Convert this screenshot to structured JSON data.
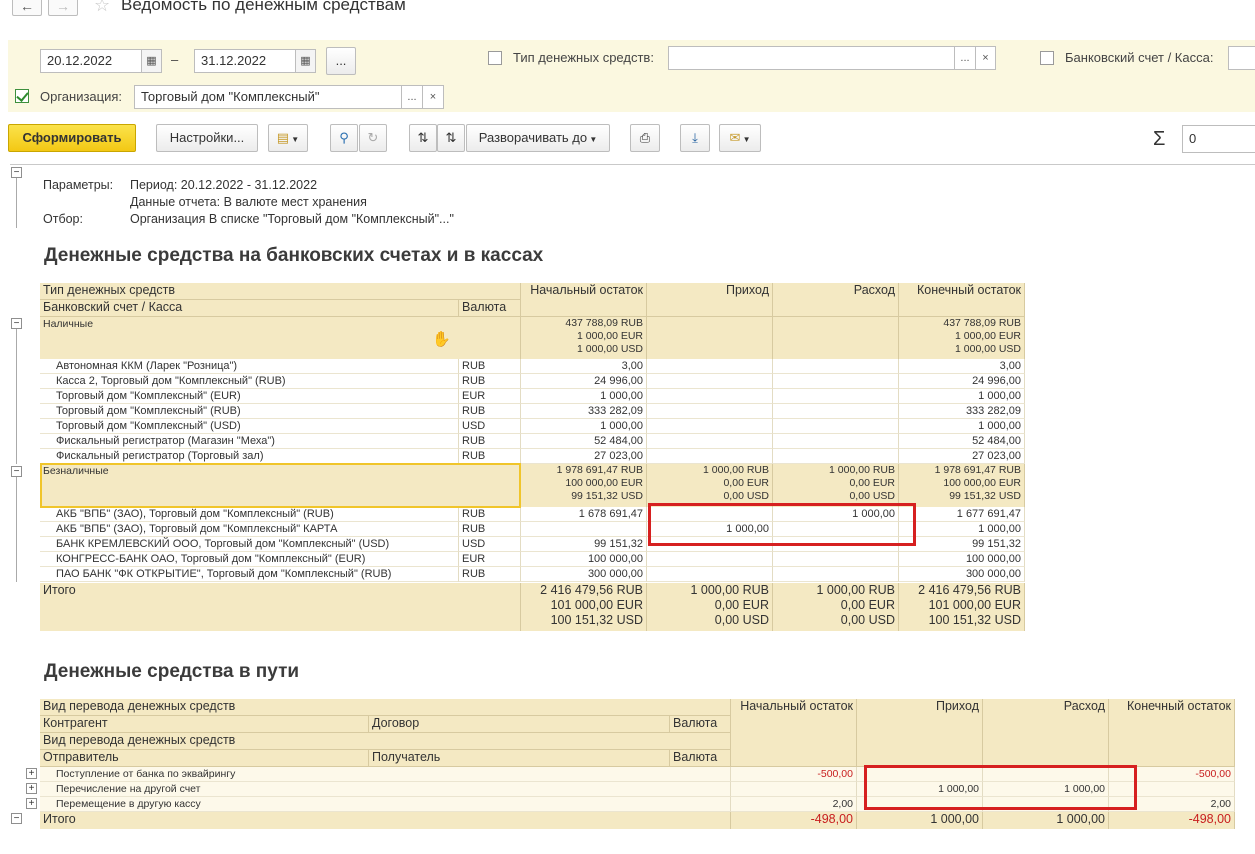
{
  "window": {
    "title": "Ведомость по денежным средствам"
  },
  "filters": {
    "date_from": "20.12.2022",
    "date_dash": "–",
    "date_to": "31.12.2022",
    "more": "...",
    "type_label": "Тип денежных средств:",
    "bank_label": "Банковский счет / Касса:",
    "org_label": "Организация:",
    "org_value": "Торговый дом \"Комплексный\"",
    "ellipsis": "...",
    "clear": "×"
  },
  "toolbar": {
    "generate": "Сформировать",
    "settings": "Настройки...",
    "expand": "Разворачивать до",
    "sigma": "Σ",
    "sum_value": "0"
  },
  "params": {
    "label": "Параметры:",
    "period": "Период: 20.12.2022 - 31.12.2022",
    "data": "Данные отчета: В валюте мест хранения",
    "filter_label": "Отбор:",
    "filter": "Организация В списке \"Торговый дом \"Комплексный\"...\""
  },
  "section1": {
    "title": "Денежные средства на банковских счетах и в кассах",
    "headers": {
      "type": "Тип денежных средств",
      "account": "Банковский счет / Касса",
      "currency": "Валюта",
      "opening": "Начальный остаток",
      "income": "Приход",
      "expense": "Расход",
      "closing": "Конечный остаток"
    },
    "cash_group": {
      "name": "Наличные",
      "opening": [
        "437 788,09 RUB",
        "1 000,00 EUR",
        "1 000,00 USD"
      ],
      "closing": [
        "437 788,09 RUB",
        "1 000,00 EUR",
        "1 000,00 USD"
      ]
    },
    "cash_rows": [
      {
        "name": "Автономная ККМ (Ларек \"Розница\")",
        "cur": "RUB",
        "opening": "3,00",
        "income": "",
        "expense": "",
        "closing": "3,00"
      },
      {
        "name": "Касса 2, Торговый дом \"Комплексный\" (RUB)",
        "cur": "RUB",
        "opening": "24 996,00",
        "income": "",
        "expense": "",
        "closing": "24 996,00"
      },
      {
        "name": "Торговый дом \"Комплексный\" (EUR)",
        "cur": "EUR",
        "opening": "1 000,00",
        "income": "",
        "expense": "",
        "closing": "1 000,00"
      },
      {
        "name": "Торговый дом \"Комплексный\" (RUB)",
        "cur": "RUB",
        "opening": "333 282,09",
        "income": "",
        "expense": "",
        "closing": "333 282,09"
      },
      {
        "name": "Торговый дом \"Комплексный\" (USD)",
        "cur": "USD",
        "opening": "1 000,00",
        "income": "",
        "expense": "",
        "closing": "1 000,00"
      },
      {
        "name": "Фискальный регистратор (Магазин \"Меха\")",
        "cur": "RUB",
        "opening": "52 484,00",
        "income": "",
        "expense": "",
        "closing": "52 484,00"
      },
      {
        "name": "Фискальный регистратор (Торговый зал)",
        "cur": "RUB",
        "opening": "27 023,00",
        "income": "",
        "expense": "",
        "closing": "27 023,00"
      }
    ],
    "noncash_group": {
      "name": "Безналичные",
      "opening": [
        "1 978 691,47 RUB",
        "100 000,00 EUR",
        "99 151,32 USD"
      ],
      "income": [
        "1 000,00 RUB",
        "0,00 EUR",
        "0,00 USD"
      ],
      "expense": [
        "1 000,00 RUB",
        "0,00 EUR",
        "0,00 USD"
      ],
      "closing": [
        "1 978 691,47 RUB",
        "100 000,00 EUR",
        "99 151,32 USD"
      ]
    },
    "noncash_rows": [
      {
        "name": "АКБ \"ВПБ\" (ЗАО), Торговый дом \"Комплексный\" (RUB)",
        "cur": "RUB",
        "opening": "1 678 691,47",
        "income": "",
        "expense": "1 000,00",
        "closing": "1 677 691,47"
      },
      {
        "name": "АКБ \"ВПБ\" (ЗАО), Торговый дом \"Комплексный\" КАРТА",
        "cur": "RUB",
        "opening": "",
        "income": "1 000,00",
        "expense": "",
        "closing": "1 000,00"
      },
      {
        "name": "БАНК КРЕМЛЕВСКИЙ ООО, Торговый дом \"Комплексный\" (USD)",
        "cur": "USD",
        "opening": "99 151,32",
        "income": "",
        "expense": "",
        "closing": "99 151,32"
      },
      {
        "name": "КОНГРЕСС-БАНК ОАО, Торговый дом \"Комплексный\" (EUR)",
        "cur": "EUR",
        "opening": "100 000,00",
        "income": "",
        "expense": "",
        "closing": "100 000,00"
      },
      {
        "name": "ПАО БАНК \"ФК ОТКРЫТИЕ\", Торговый дом \"Комплексный\" (RUB)",
        "cur": "RUB",
        "opening": "300 000,00",
        "income": "",
        "expense": "",
        "closing": "300 000,00"
      }
    ],
    "total": {
      "label": "Итого",
      "opening": [
        "2 416 479,56 RUB",
        "101 000,00 EUR",
        "100 151,32 USD"
      ],
      "income": [
        "1 000,00 RUB",
        "0,00 EUR",
        "0,00 USD"
      ],
      "expense": [
        "1 000,00 RUB",
        "0,00 EUR",
        "0,00 USD"
      ],
      "closing": [
        "2 416 479,56 RUB",
        "101 000,00 EUR",
        "100 151,32 USD"
      ]
    }
  },
  "section2": {
    "title": "Денежные средства в пути",
    "headers": {
      "kind": "Вид перевода денежных средств",
      "counterparty": "Контрагент",
      "contract": "Договор",
      "currency": "Валюта",
      "kind2": "Вид перевода денежных средств",
      "sender": "Отправитель",
      "receiver": "Получатель",
      "currency2": "Валюта",
      "opening": "Начальный остаток",
      "income": "Приход",
      "expense": "Расход",
      "closing": "Конечный остаток"
    },
    "rows": [
      {
        "name": "Поступление от банка по эквайрингу",
        "opening": "-500,00",
        "income": "",
        "expense": "",
        "closing": "-500,00"
      },
      {
        "name": "Перечисление на другой счет",
        "opening": "",
        "income": "1 000,00",
        "expense": "1 000,00",
        "closing": ""
      },
      {
        "name": "Перемещение в другую кассу",
        "opening": "2,00",
        "income": "",
        "expense": "",
        "closing": "2,00"
      }
    ],
    "total": {
      "label": "Итого",
      "opening": "-498,00",
      "income": "1 000,00",
      "expense": "1 000,00",
      "closing": "-498,00"
    }
  },
  "colors": {
    "header_bg": "#f4e9c3",
    "filter_bg": "#fbf8e0",
    "highlight_red": "#d62020",
    "highlight_yellow": "#f0c52a",
    "negative": "#c81e1e"
  }
}
